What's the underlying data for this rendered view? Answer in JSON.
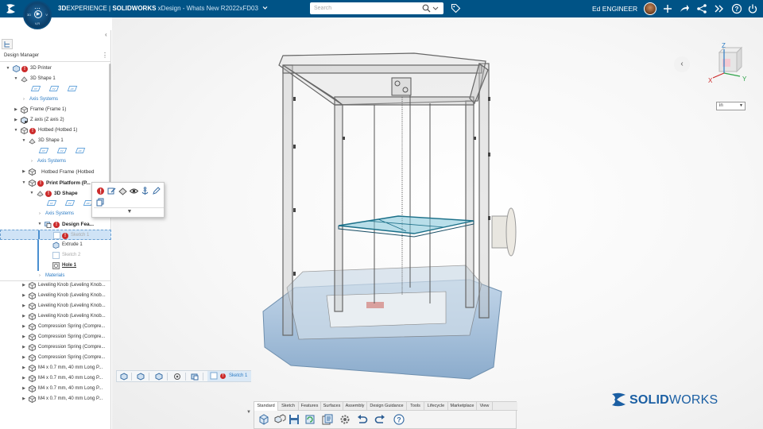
{
  "topbar": {
    "brand_prefix": "3D",
    "brand_main": "EXPERIENCE | ",
    "brand_product": "SOLIDWORKS",
    "context": " xDesign - Whats New R2022xFD03",
    "search_placeholder": "Search",
    "user_name": "Ed ENGINEER",
    "compass": {
      "top": "⋯",
      "left": "3D",
      "right": "V",
      "bottom": "V,R"
    }
  },
  "panel": {
    "title": "Design Manager"
  },
  "tree": {
    "items": [
      "3D Printer",
      "3D Shape 1",
      "Axis Systems",
      "Frame (Frame 1)",
      "Z axis (Z axis 2)",
      "Hotbed (Hotbed 1)",
      "3D Shape 1",
      "Axis Systems",
      "Hotbed Frame (Hotbed",
      "Print Platform (P...",
      "3D Shape",
      "Axis Systems",
      "Design Fea...",
      "Sketch 1",
      "Extrude 1",
      "Sketch 2",
      "Hole 1",
      "Materials",
      "Leveling Knob (Leveling Knob...",
      "Leveling Knob (Leveling Knob...",
      "Leveling Knob (Leveling Knob...",
      "Leveling Knob (Leveling Knob...",
      "Compression Spring (Compre...",
      "Compression Spring (Compre...",
      "Compression Spring (Compre...",
      "Compression Spring (Compre...",
      "M4 x 0.7 mm, 40 mm Long P...",
      "M4 x 0.7 mm, 40 mm Long P...",
      "M4 x 0.7 mm, 40 mm Long P...",
      "M4 x 0.7 mm, 40 mm Long P..."
    ],
    "plane_labels": [
      "XY",
      "YZ",
      "ZX"
    ]
  },
  "viewport": {
    "unit": "in",
    "triad": {
      "x": "X",
      "y": "Y",
      "z": "Z"
    },
    "logo_prefix": "SOLID",
    "logo_suffix": "WORKS"
  },
  "breadcrumb": {
    "last": "Sketch 1"
  },
  "actionbar": {
    "tabs": [
      "Standard",
      "Sketch",
      "Features",
      "Surfaces",
      "Assembly",
      "Design Guidance",
      "Tools",
      "Lifecycle",
      "Marketplace",
      "View"
    ],
    "active_tab": "Standard"
  },
  "colors": {
    "topbar": "#005386",
    "accent": "#2b7bc4",
    "error": "#cc2b2b",
    "selection": "#cfe3f6"
  }
}
